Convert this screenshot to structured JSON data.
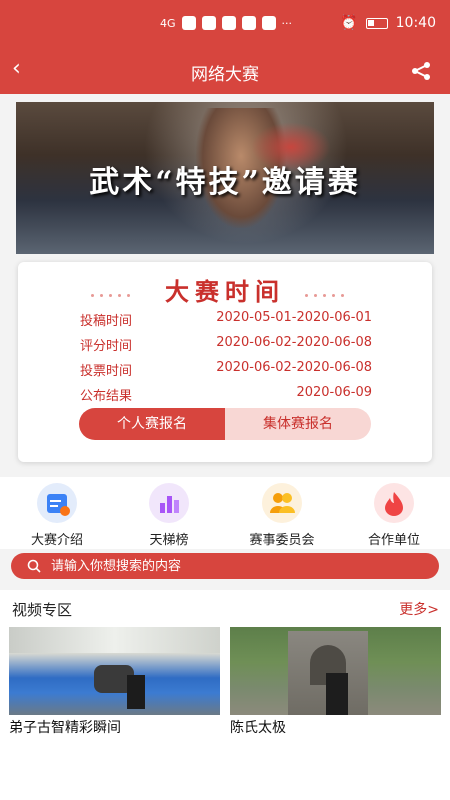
{
  "status": {
    "time": "10:40",
    "network": "4G",
    "more": "···"
  },
  "appbar": {
    "title": "网络大赛",
    "back_glyph": "‹"
  },
  "banner": {
    "headline": "武术“特技”邀请赛"
  },
  "schedule": {
    "title": "大赛时间",
    "rows": [
      {
        "label": "投稿时间",
        "value": "2020-05-01-2020-06-01"
      },
      {
        "label": "评分时间",
        "value": "2020-06-02-2020-06-08"
      },
      {
        "label": "投票时间",
        "value": "2020-06-02-2020-06-08"
      },
      {
        "label": "公布结果",
        "value": "2020-06-09"
      }
    ],
    "individual_btn": "个人赛报名",
    "team_btn": "集体赛报名"
  },
  "quick": [
    {
      "label": "大赛介绍",
      "icon": "calendar-icon",
      "color": "#3b82f6"
    },
    {
      "label": "天梯榜",
      "icon": "chart-icon",
      "color": "#a855f7"
    },
    {
      "label": "赛事委员会",
      "icon": "users-icon",
      "color": "#f59e0b"
    },
    {
      "label": "合作单位",
      "icon": "flame-icon",
      "color": "#ef4444"
    }
  ],
  "search": {
    "placeholder": "请输入你想搜索的内容"
  },
  "videos": {
    "title": "视频专区",
    "more": "更多>",
    "items": [
      {
        "label": "弟子古智精彩瞬间"
      },
      {
        "label": "陈氏太极"
      }
    ]
  },
  "colors": {
    "primary": "#d7453e",
    "accent_text": "#c9302c"
  }
}
